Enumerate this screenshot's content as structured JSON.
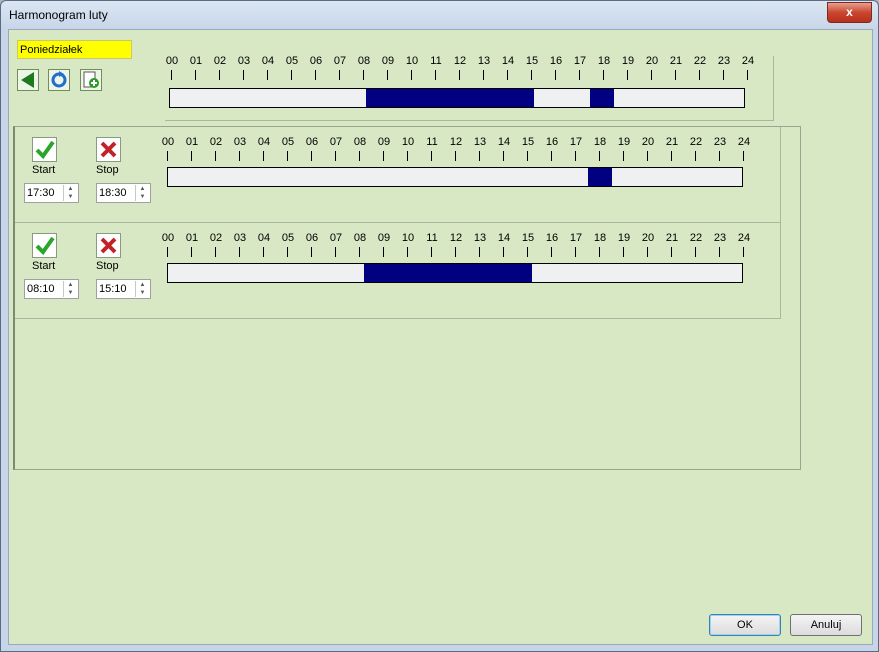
{
  "window": {
    "title": "Harmonogram luty",
    "close_glyph": "x"
  },
  "day_label": "Poniedziałek",
  "toolbar": {
    "icons": [
      "back-arrow-icon",
      "refresh-icon",
      "new-document-icon"
    ]
  },
  "hours": [
    "00",
    "01",
    "02",
    "03",
    "04",
    "05",
    "06",
    "07",
    "08",
    "09",
    "10",
    "11",
    "12",
    "13",
    "14",
    "15",
    "16",
    "17",
    "18",
    "19",
    "20",
    "21",
    "22",
    "23",
    "24"
  ],
  "summary_segments": [
    {
      "start": "08:10",
      "stop": "15:10"
    },
    {
      "start": "17:30",
      "stop": "18:30"
    }
  ],
  "rows": [
    {
      "start_label": "Start",
      "stop_label": "Stop",
      "start_value": "17:30",
      "stop_value": "18:30"
    },
    {
      "start_label": "Start",
      "stop_label": "Stop",
      "start_value": "08:10",
      "stop_value": "15:10"
    }
  ],
  "buttons": {
    "ok": "OK",
    "cancel": "Anuluj"
  },
  "colors": {
    "segment": "#000080",
    "background": "#d8e8c4",
    "day_label_bg": "#ffff00"
  }
}
